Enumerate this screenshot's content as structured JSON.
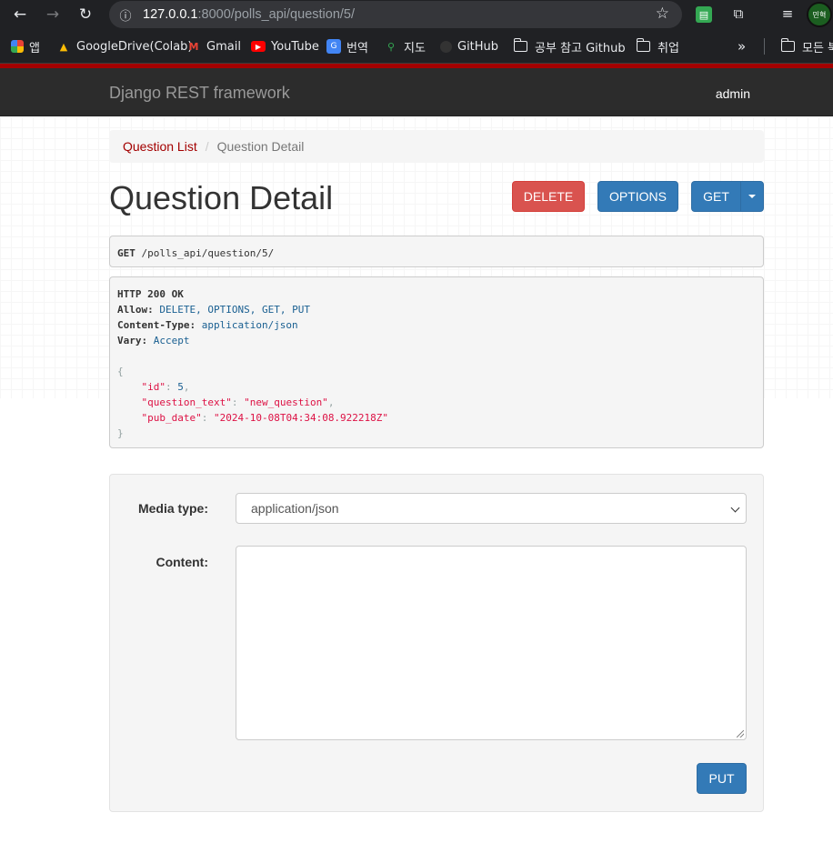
{
  "browser": {
    "url_host": "127.0.0.1",
    "url_path": ":8000/polls_api/question/5/",
    "bookmarks": [
      {
        "label": "앱",
        "icon": "apps-grid-icon"
      },
      {
        "label": "GoogleDrive(Colab)",
        "icon": "google-drive-icon"
      },
      {
        "label": "Gmail",
        "icon": "gmail-icon"
      },
      {
        "label": "YouTube",
        "icon": "youtube-icon"
      },
      {
        "label": "번역",
        "icon": "translate-icon"
      },
      {
        "label": "지도",
        "icon": "maps-icon"
      },
      {
        "label": "GitHub",
        "icon": "github-icon"
      },
      {
        "label": "공부 참고 Github",
        "icon": "folder-icon"
      },
      {
        "label": "취업",
        "icon": "folder-icon"
      },
      {
        "label": "모든 북",
        "icon": "folder-icon"
      }
    ],
    "overflow_label": "»",
    "profile_label": "민혁"
  },
  "navbar": {
    "brand": "Django REST framework",
    "user": "admin"
  },
  "breadcrumb": {
    "link": "Question List",
    "separator": "/",
    "active": "Question Detail"
  },
  "page_title": "Question Detail",
  "buttons": {
    "delete": "DELETE",
    "options": "OPTIONS",
    "get": "GET",
    "put": "PUT"
  },
  "request": {
    "method": "GET",
    "path": " /polls_api/question/5/"
  },
  "response": {
    "status": "HTTP 200 OK",
    "allow_key": "Allow:",
    "allow_val": "DELETE, OPTIONS, GET, PUT",
    "ctype_key": "Content-Type:",
    "ctype_val": "application/json",
    "vary_key": "Vary:",
    "vary_val": "Accept",
    "open": "{",
    "close": "}",
    "fields": [
      {
        "key": "\"id\"",
        "value": "5",
        "comma": ","
      },
      {
        "key": "\"question_text\"",
        "value": "\"new_question\"",
        "comma": ","
      },
      {
        "key": "\"pub_date\"",
        "value": "\"2024-10-08T04:34:08.922218Z\"",
        "comma": ""
      }
    ]
  },
  "form": {
    "media_type_label": "Media type:",
    "media_type_value": "application/json",
    "content_label": "Content:",
    "content_value": ""
  },
  "colors": {
    "brand_red": "#a30000",
    "primary": "#337ab7",
    "danger": "#d9534f"
  }
}
